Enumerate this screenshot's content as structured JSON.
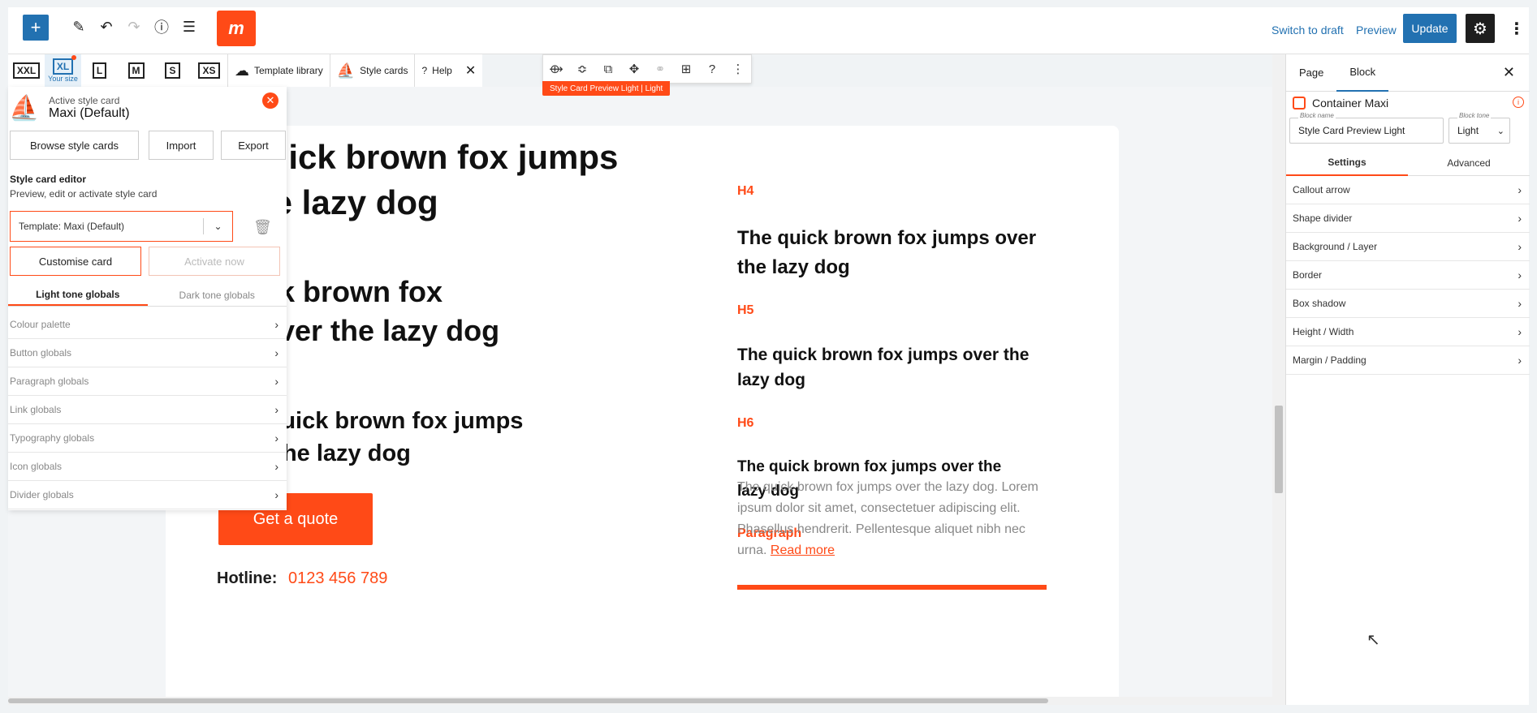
{
  "topbar": {
    "add_icon": "plus-icon",
    "switch_to_draft": "Switch to draft",
    "preview": "Preview",
    "update": "Update"
  },
  "responsive": {
    "sizes": [
      {
        "label": "XXL",
        "sub": ""
      },
      {
        "label": "XL",
        "sub": "Your size"
      },
      {
        "label": "L",
        "sub": ""
      },
      {
        "label": "M",
        "sub": ""
      },
      {
        "label": "S",
        "sub": ""
      },
      {
        "label": "XS",
        "sub": ""
      }
    ],
    "template_library": "Template library",
    "style_cards": "Style cards",
    "help": "Help"
  },
  "block_toolbar": {
    "label": "Style Card Preview Light | Light"
  },
  "style_card": {
    "active_label": "Active style card",
    "name": "Maxi (Default)",
    "browse": "Browse style cards",
    "import": "Import",
    "export": "Export",
    "editor_title": "Style card editor",
    "editor_sub": "Preview, edit or activate style card",
    "template_value": "Template: Maxi (Default)",
    "customise": "Customise card",
    "activate": "Activate now",
    "tabs": [
      "Light tone globals",
      "Dark tone globals"
    ],
    "globals": [
      "Colour palette",
      "Button globals",
      "Paragraph globals",
      "Link globals",
      "Typography globals",
      "Icon globals",
      "Divider globals"
    ]
  },
  "canvas": {
    "h1": "e quick brown fox jumps\nr the lazy dog",
    "h2": "quick brown fox\nps over the lazy dog",
    "h3": "The quick brown fox jumps\nover the lazy dog",
    "cta": "Get a quote",
    "hotline_label": "Hotline:",
    "hotline_number": "0123 456 789",
    "h4_label": "H4",
    "h4_text": "The quick brown fox jumps over the lazy dog",
    "h5_label": "H5",
    "h5_text": "The quick brown fox jumps over the lazy dog",
    "h6_label": "H6",
    "h6_text": "The quick brown fox jumps over the lazy dog",
    "paragraph_label": "Paragraph",
    "paragraph_text": "The quick brown fox jumps over the lazy dog. Lorem ipsum dolor sit amet, consectetuer adipiscing elit. Phasellus hendrerit. Pellentesque aliquet nibh nec urna.",
    "read_more": "Read more"
  },
  "sidebar": {
    "tabs": [
      "Page",
      "Block"
    ],
    "block_title": "Container Maxi",
    "block_name_label": "Block name",
    "block_name_value": "Style Card Preview Light",
    "block_tone_label": "Block tone",
    "block_tone_value": "Light",
    "subtabs": [
      "Settings",
      "Advanced"
    ],
    "sections": [
      "Callout arrow",
      "Shape divider",
      "Background / Layer",
      "Border",
      "Box shadow",
      "Height / Width",
      "Margin / Padding"
    ]
  },
  "colors": {
    "accent": "#ff4a17",
    "primary": "#2271b1"
  }
}
